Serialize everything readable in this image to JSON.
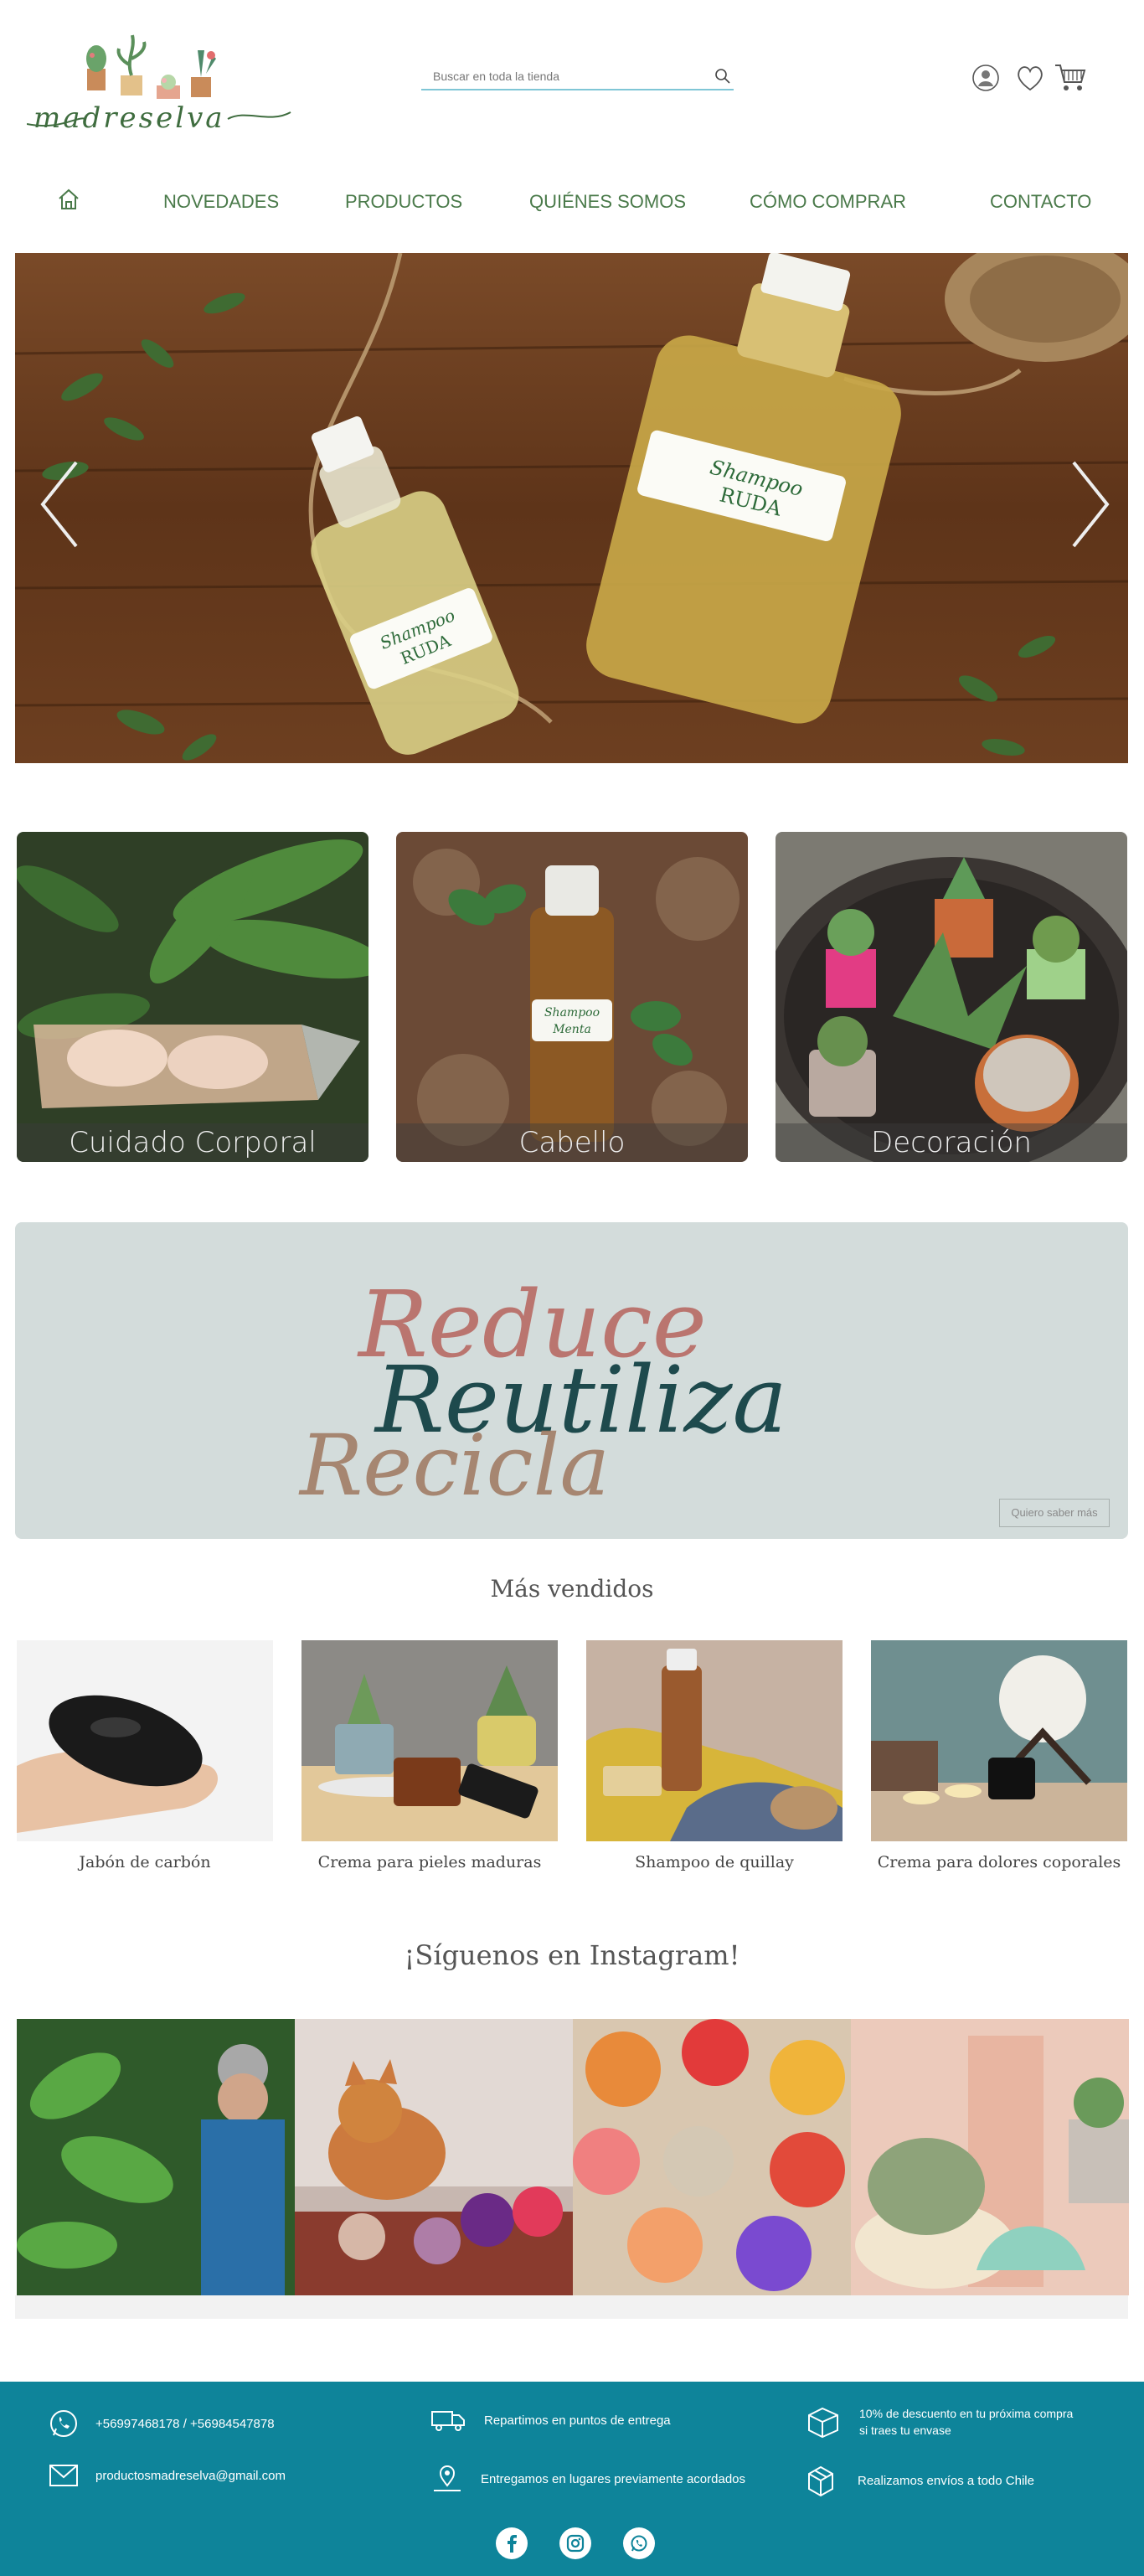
{
  "brand": {
    "logo_text": "madreselva"
  },
  "search": {
    "placeholder": "Buscar en toda la tienda"
  },
  "header_icons": [
    "user-icon",
    "heart-icon",
    "cart-icon"
  ],
  "nav": {
    "home_icon": "home-icon",
    "items": [
      "NOVEDADES",
      "PRODUCTOS",
      "QUIÉNES SOMOS",
      "CÓMO COMPRAR",
      "CONTACTO"
    ]
  },
  "hero": {
    "bottle_small_label": [
      "Shampoo",
      "RUDA"
    ],
    "bottle_large_label": [
      "Shampoo",
      "RUDA"
    ]
  },
  "categories": [
    {
      "label": "Cuidado Corporal"
    },
    {
      "label": "Cabello",
      "bottle_label": [
        "Shampoo",
        "Menta"
      ]
    },
    {
      "label": "Decoración"
    }
  ],
  "banner": {
    "words": [
      "Reduce",
      "Reutiliza",
      "Recicla"
    ],
    "button": "Quiero saber más"
  },
  "bestsellers": {
    "title": "Más vendidos",
    "items": [
      "Jabón de carbón",
      "Crema para pieles maduras",
      "Shampoo de quillay",
      "Crema para dolores coporales"
    ]
  },
  "instagram": {
    "title": "¡Síguenos en Instagram!"
  },
  "footer": {
    "phone": "+56997468178 / +56984547878",
    "email": "productosmadreselva@gmail.com",
    "delivery": "Repartimos en puntos de entrega",
    "meeting": "Entregamos en lugares previamente acordados",
    "discount_line1": "10% de descuento en tu próxima compra",
    "discount_line2": "si traes tu envase",
    "shipping": "Realizamos envíos a todo Chile"
  },
  "social": [
    "facebook-icon",
    "instagram-icon",
    "whatsapp-icon"
  ],
  "colors": {
    "nav_green": "#4a7a4a",
    "footer_teal": "#0e849a",
    "banner_bg": "#d3dcdb"
  }
}
